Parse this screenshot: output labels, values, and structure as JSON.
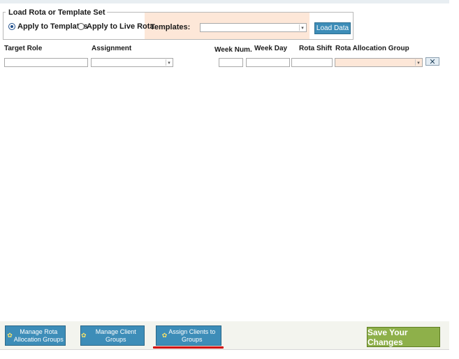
{
  "load_section": {
    "legend": "Load Rota or Template Set",
    "radio_templates": "Apply to Templates",
    "radio_live": "Apply to Live Rota",
    "templates_label": "Templates:",
    "templates_value": "",
    "load_button": "Load Data"
  },
  "columns": {
    "target_role": "Target Role",
    "assignment": "Assignment",
    "week_num": "Week Num.",
    "week_day": "Week Day",
    "rota_shift": "Rota Shift",
    "rota_allocation_group": "Rota Allocation Group"
  },
  "remove_button": "✕",
  "footer": {
    "manage_rota_line1": "Manage Rota",
    "manage_rota_line2": "Allocation Groups",
    "manage_client": "Manage Client Groups",
    "assign_line1": "Assign Clients to",
    "assign_line2": "Groups",
    "save": "Save Your Changes"
  },
  "colors": {
    "accent": "#3d8db8",
    "save": "#8eb04a",
    "highlight": "#fde7d8",
    "underline": "#d10000"
  }
}
